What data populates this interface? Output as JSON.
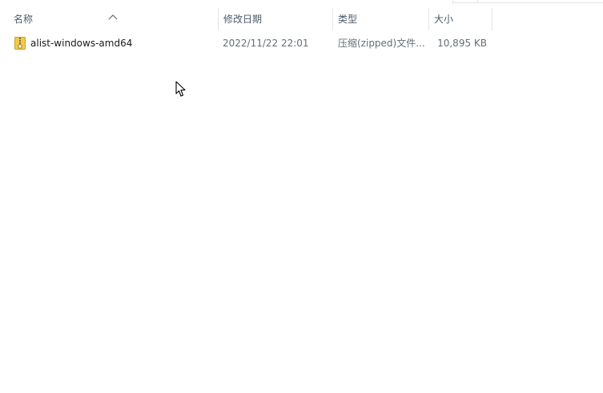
{
  "columns": {
    "name": "名称",
    "date_modified": "修改日期",
    "type": "类型",
    "size": "大小"
  },
  "sort": {
    "column": "name",
    "direction": "ascending",
    "icon": "chevron-up-icon"
  },
  "files": [
    {
      "icon": "zip-folder-icon",
      "name": "alist-windows-amd64",
      "date_modified": "2022/11/22 22:01",
      "type": "压缩(zipped)文件...",
      "size": "10,895 KB"
    }
  ],
  "colors": {
    "header_text": "#4d5a6b",
    "detail_text": "#666d78",
    "zip_icon": "#f2c94c"
  }
}
